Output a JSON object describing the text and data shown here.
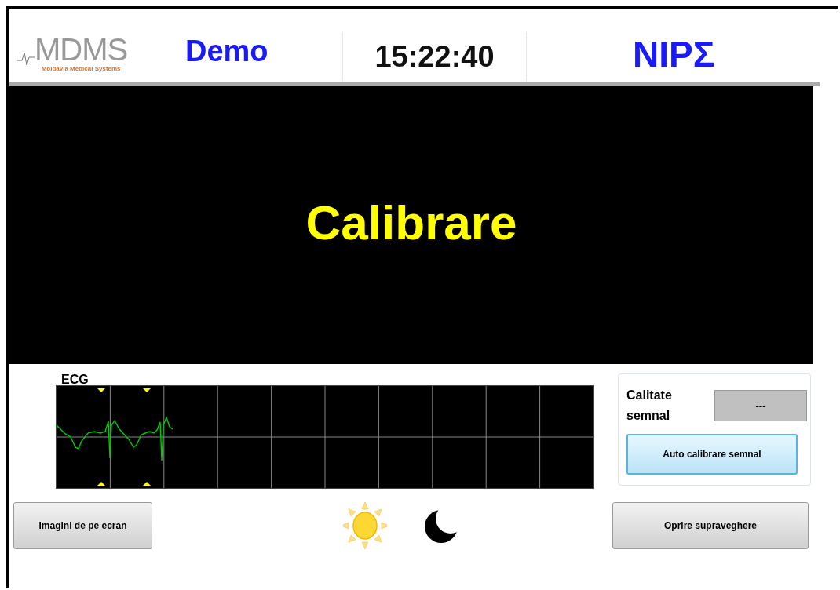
{
  "header": {
    "logo": {
      "mark": "MDMS",
      "tagline": "Moldavia Medical Systems"
    },
    "mode": "Demo",
    "clock": "15:22:40",
    "monitor": "NIPΣ"
  },
  "main_display": {
    "message": "Calibrare"
  },
  "ecg": {
    "label": "ECG"
  },
  "signal_panel": {
    "label": "Calitate semnal",
    "value": "---",
    "button": "Auto calibrare semnal"
  },
  "buttons": [
    {
      "kind": "left",
      "label": "Imagini de pe ecran"
    },
    {
      "kind": "right",
      "label": "Oprire supraveghere"
    }
  ]
}
